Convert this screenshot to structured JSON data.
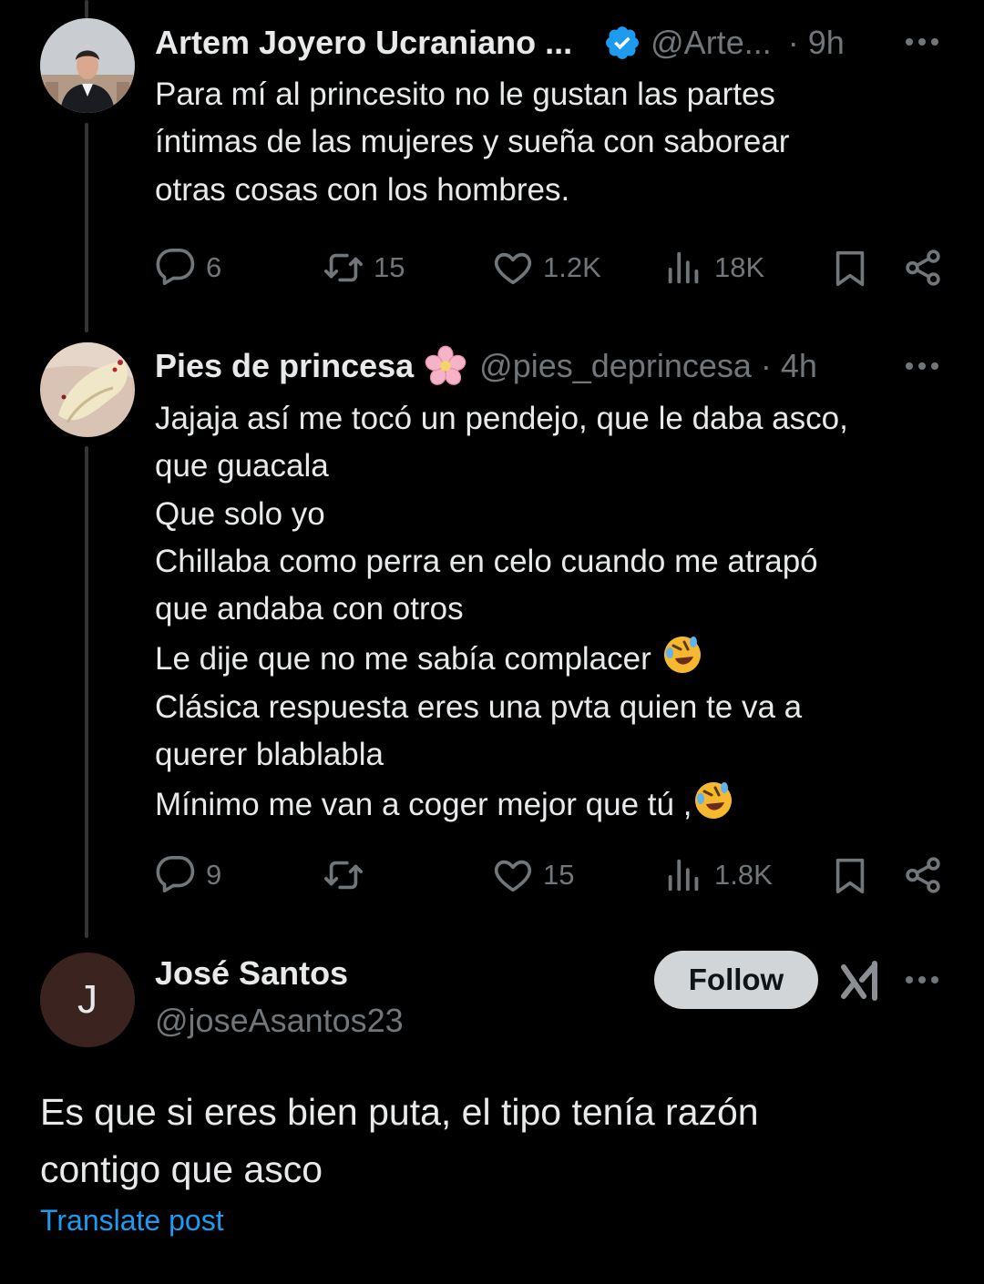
{
  "tweets": [
    {
      "author_name": "Artem Joyero Ucraniano ...",
      "handle": "@Arte...",
      "time": "· 9h",
      "text_lines": [
        "Para mí al princesito no le gustan las partes",
        "íntimas de las mujeres y sueña con saborear",
        "otras cosas con los hombres."
      ],
      "stats": {
        "replies": "6",
        "reposts": "15",
        "likes": "1.2K",
        "views": "18K"
      }
    },
    {
      "author_name": "Pies de princesa",
      "handle": "@pies_deprincesa",
      "time": "· 4h",
      "text_lines": [
        "Jajaja así me tocó un pendejo, que le daba asco,",
        "que guacala",
        "Que solo yo",
        "Chillaba como perra en celo cuando me atrapó",
        "que andaba con otros",
        "Le dije que no me sabía complacer",
        "Clásica respuesta eres una pvta quien te va a",
        "querer blablabla",
        "Mínimo me van a coger mejor que tú ,"
      ],
      "stats": {
        "replies": "9",
        "reposts": "",
        "likes": "15",
        "views": "1.8K"
      }
    }
  ],
  "focused": {
    "avatar_letter": "J",
    "author_name": "José Santos",
    "handle": "@joseAsantos23",
    "follow_label": "Follow",
    "text_lines": [
      "Es que si eres bien puta, el tipo tenía razón",
      "contigo que asco"
    ],
    "translate_label": "Translate post"
  },
  "colors": {
    "background": "#000000",
    "text": "#e7e9ea",
    "muted": "#71767b",
    "link": "#1d9bf0",
    "verified": "#1d9bf0"
  },
  "icons": [
    "reply-icon",
    "repost-icon",
    "like-icon",
    "views-icon",
    "bookmark-icon",
    "share-icon",
    "more-icon",
    "verified-badge-icon",
    "cherry-blossom-icon",
    "grok-icon",
    "rolling-laughing-emoji-icon"
  ]
}
